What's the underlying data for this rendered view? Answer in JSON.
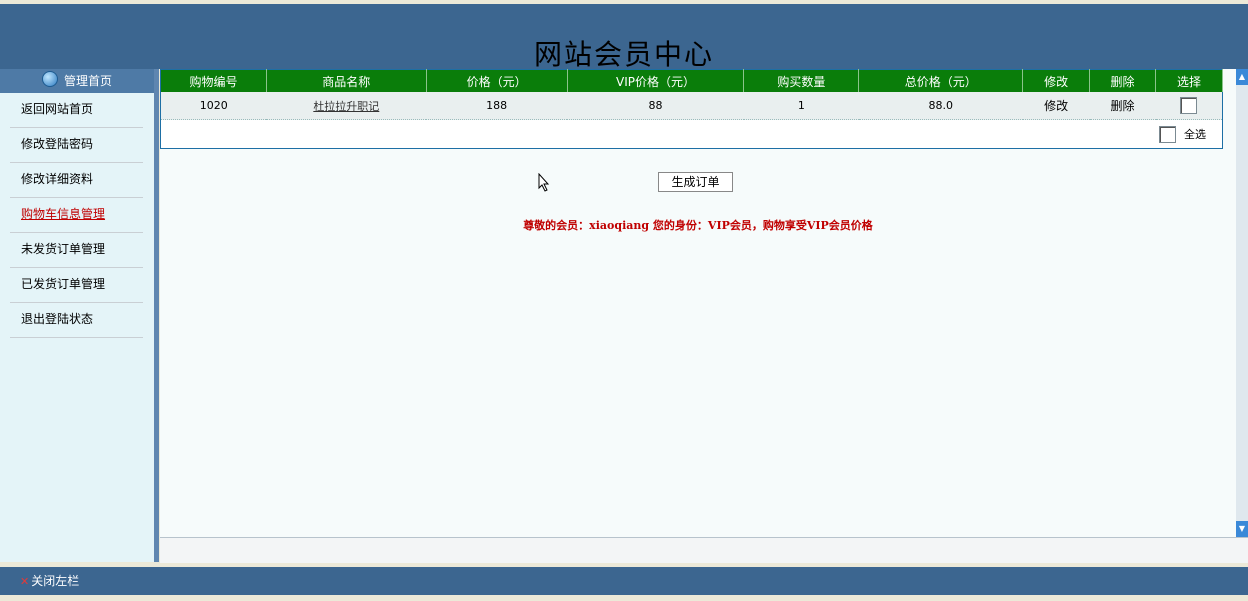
{
  "header": {
    "title": "网站会员中心"
  },
  "sidebar": {
    "heading": "管理首页",
    "items": [
      {
        "label": "返回网站首页"
      },
      {
        "label": "修改登陆密码"
      },
      {
        "label": "修改详细资料"
      },
      {
        "label": "购物车信息管理"
      },
      {
        "label": "未发货订单管理"
      },
      {
        "label": "已发货订单管理"
      },
      {
        "label": "退出登陆状态"
      }
    ]
  },
  "cart": {
    "columns": [
      "购物编号",
      "商品名称",
      "价格（元）",
      "VIP价格（元）",
      "购买数量",
      "总价格（元）",
      "修改",
      "删除",
      "选择"
    ],
    "rows": [
      {
        "id": "1020",
        "name": "杜拉拉升职记",
        "price": "188",
        "vip_price": "88",
        "qty": "1",
        "total": "88.0",
        "edit": "修改",
        "delete": "删除"
      }
    ],
    "select_all": "全选"
  },
  "actions": {
    "generate_order": "生成订单"
  },
  "notice": "尊敬的会员：xiaoqiang 您的身份：VIP会员，购物享受VIP会员价格",
  "footer": {
    "close_left": "关闭左栏"
  },
  "colors": {
    "header": "#3c6690",
    "table_head": "#0a7d0a",
    "notice": "#c00000"
  }
}
